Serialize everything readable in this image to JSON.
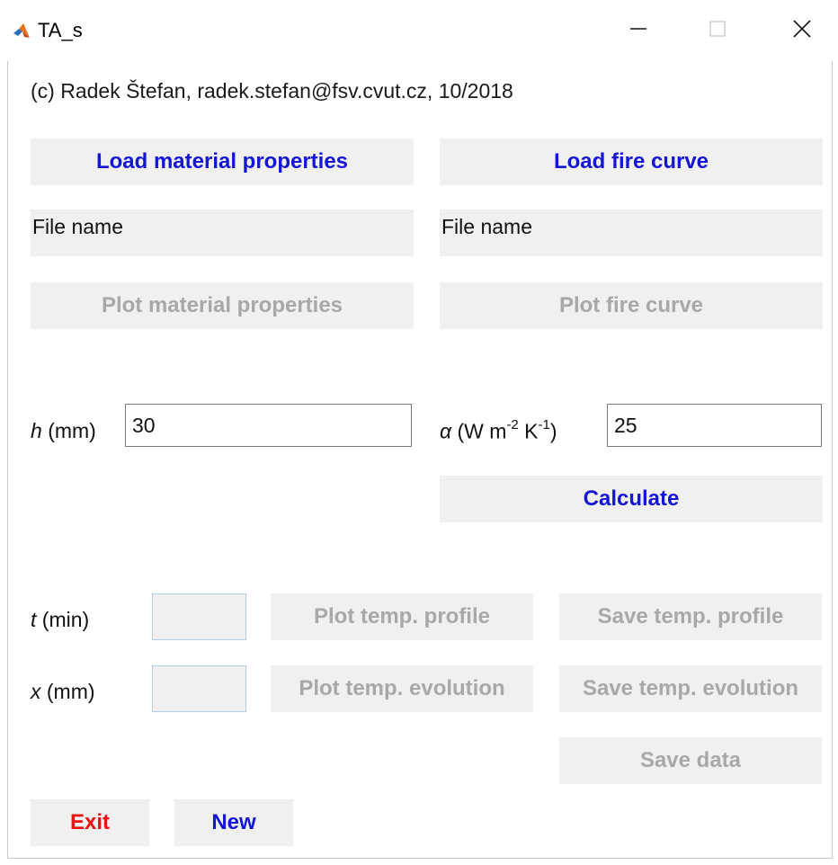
{
  "window": {
    "title": "TA_s"
  },
  "header": {
    "copyright": "(c) Radek Štefan, radek.stefan@fsv.cvut.cz, 10/2018"
  },
  "materials": {
    "load_label": "Load material properties",
    "file_name": "File name",
    "plot_label": "Plot material properties"
  },
  "fire": {
    "load_label": "Load fire curve",
    "file_name": "File name",
    "plot_label": "Plot fire curve"
  },
  "params": {
    "h_symbol": "h",
    "h_unit": "(mm)",
    "h_value": "30",
    "alpha_symbol": "α",
    "alpha_unit_w": "(W m",
    "alpha_exp_m": "-2",
    "alpha_unit_k": "K",
    "alpha_exp_k": "-1",
    "alpha_close": ")",
    "alpha_value": "25",
    "calculate_label": "Calculate"
  },
  "results": {
    "t_symbol": "t",
    "t_unit": "(min)",
    "t_value": "",
    "x_symbol": "x",
    "x_unit": "(mm)",
    "x_value": "",
    "plot_profile_label": "Plot temp. profile",
    "save_profile_label": "Save temp. profile",
    "plot_evolution_label": "Plot temp. evolution",
    "save_evolution_label": "Save temp. evolution",
    "save_data_label": "Save data"
  },
  "footer": {
    "exit_label": "Exit",
    "new_label": "New"
  },
  "colors": {
    "accent_blue": "#1515d6",
    "exit_red": "#ee1111",
    "disabled_text": "#a8a8a8",
    "button_bg": "#f0f0f0"
  },
  "icons": {
    "app": "matlab-icon",
    "minimize": "minimize-icon",
    "maximize": "maximize-icon",
    "close": "close-icon"
  }
}
